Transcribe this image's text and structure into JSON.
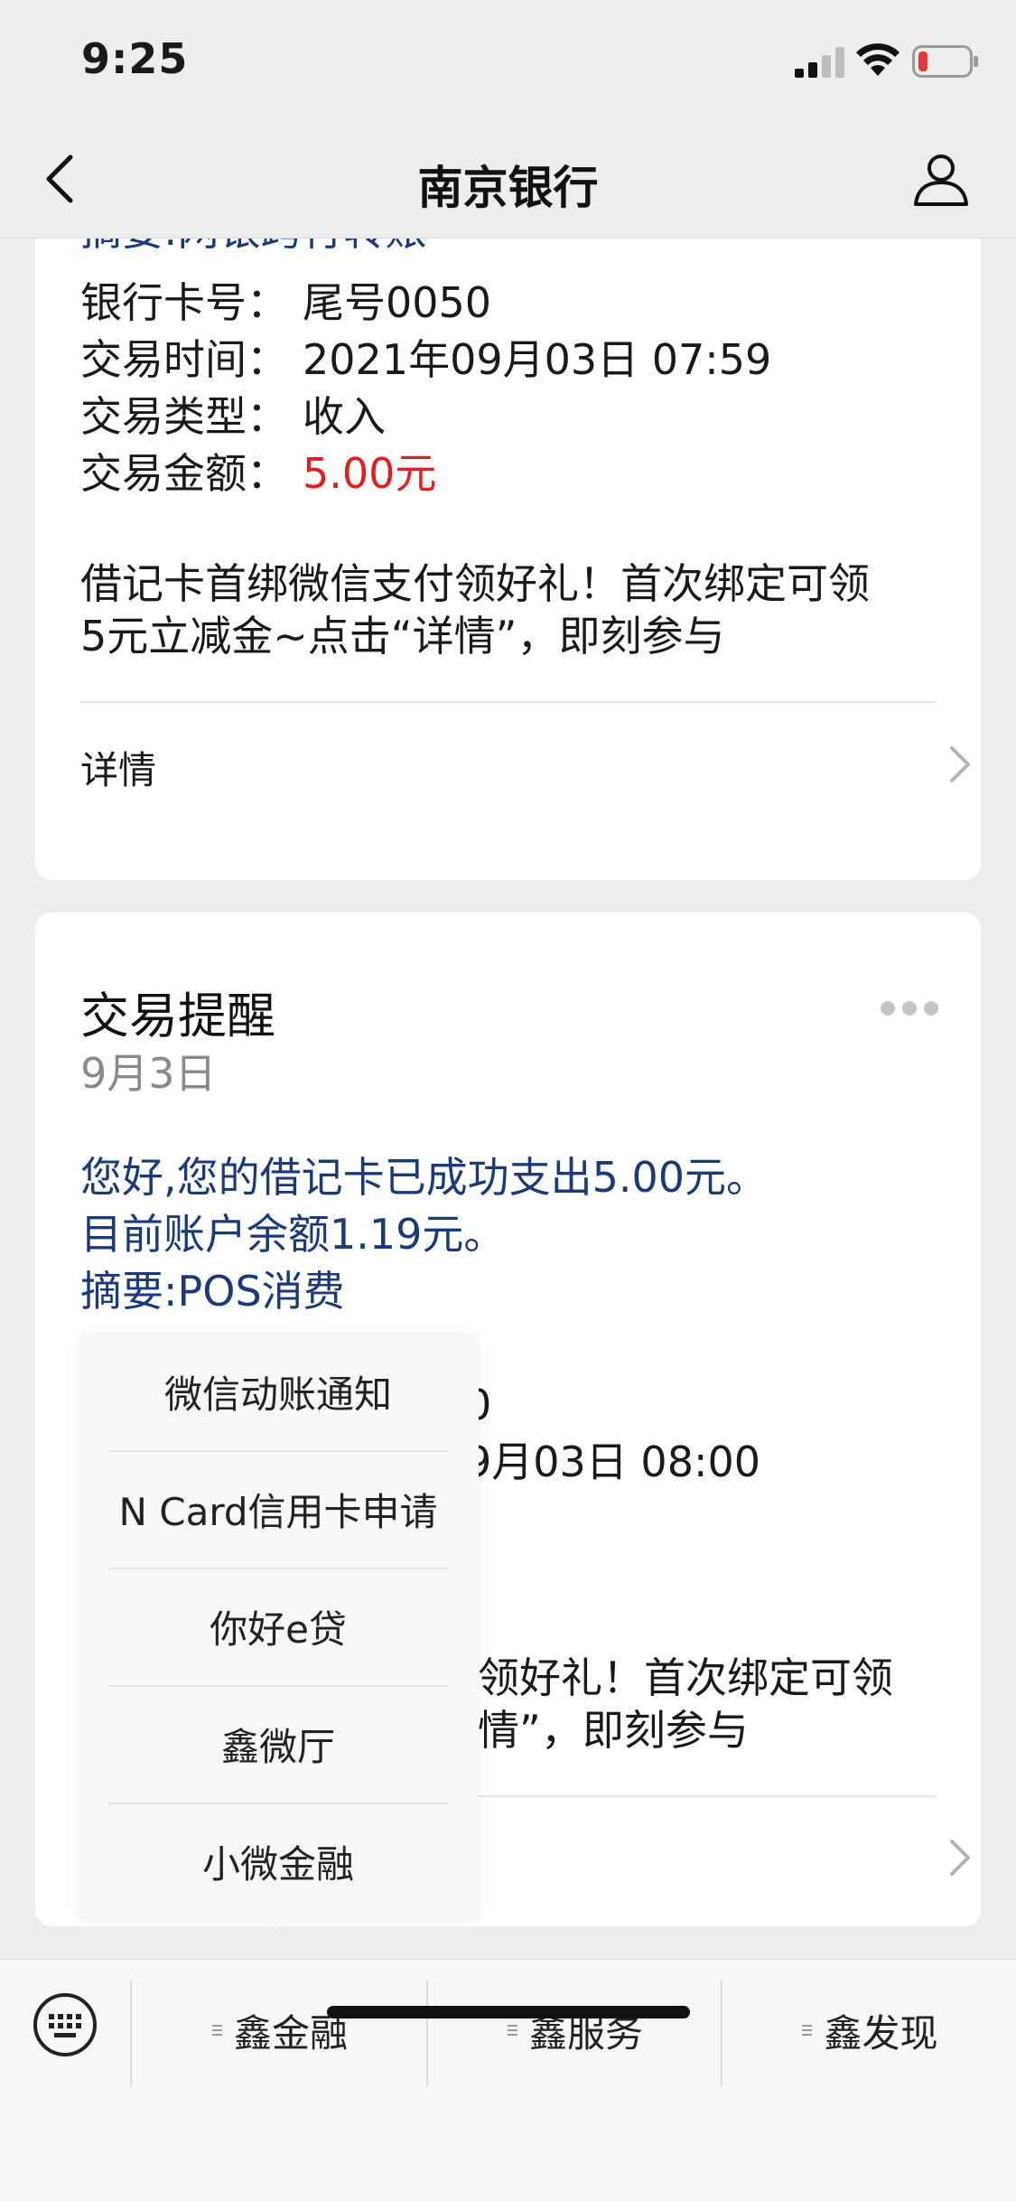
{
  "status_bar": {
    "time": "9:25"
  },
  "nav": {
    "title": "南京银行"
  },
  "card1": {
    "summary_partial": "摘要:网银跨行转账",
    "fields": [
      {
        "label": "银行卡号：",
        "value": "尾号0050"
      },
      {
        "label": "交易时间：",
        "value": "2021年09月03日 07:59"
      },
      {
        "label": "交易类型：",
        "value": "收入"
      },
      {
        "label": "交易金额：",
        "value": "5.00元"
      }
    ],
    "promo_line1": "借记卡首绑微信支付领好礼！首次绑定可领",
    "promo_line2": "5元立减金~点击“详情”，即刻参与",
    "detail_label": "详情"
  },
  "card2": {
    "title": "交易提醒",
    "date": "9月3日",
    "message_line1": "您好,您的借记卡已成功支出5.00元。",
    "message_line2": "目前账户余额1.19元。",
    "message_line3": "摘要:POS消费",
    "partial_field1": "0",
    "partial_field2": "9月03日 08:00",
    "promo_partial1": "领好礼！首次绑定可领",
    "promo_partial2": "情”，即刻参与"
  },
  "popup_menu": {
    "items": [
      "微信动账通知",
      "N Card信用卡申请",
      "你好e贷",
      "鑫微厅",
      "小微金融"
    ]
  },
  "bottom_menu": {
    "items": [
      "鑫金融",
      "鑫服务",
      "鑫发现"
    ]
  },
  "colors": {
    "accent_blue": "#1b3a7a",
    "amount_red": "#e02020",
    "background": "#ededed"
  }
}
